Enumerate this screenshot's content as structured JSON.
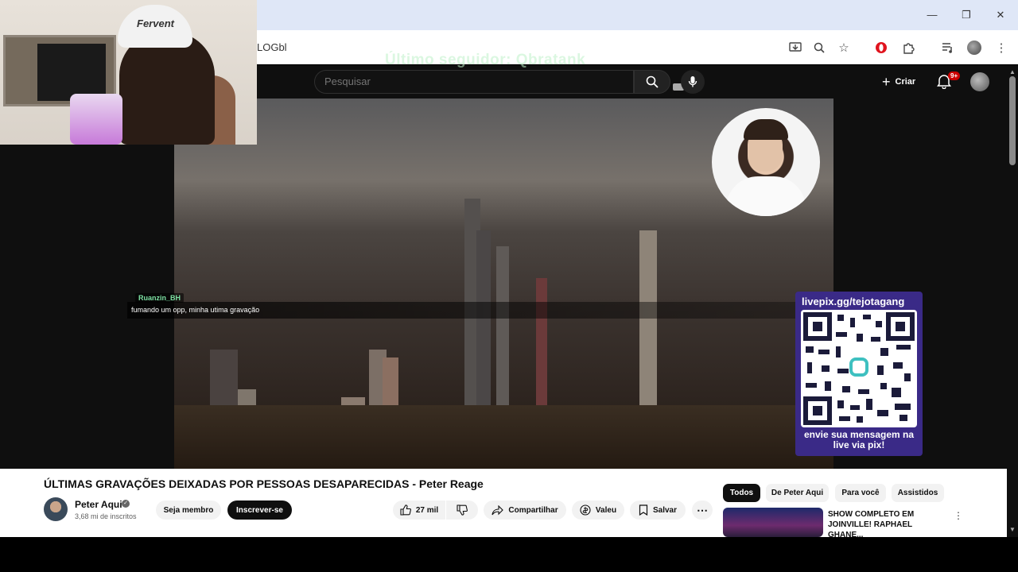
{
  "browser": {
    "url_fragment": "LOGbl",
    "window_controls": [
      "minimize",
      "restore",
      "close"
    ]
  },
  "stream_overlay": {
    "last_follower": "Último seguidor: Qbratank",
    "webcam_cap_text": "Fervent",
    "chat": {
      "username": "Ruanzin_BH",
      "message": "fumando um opp, minha utima gravação"
    },
    "donation": {
      "url": "livepix.gg/tejotagang",
      "caption_line1": "envie sua mensagem na",
      "caption_line2": "live via pix!"
    }
  },
  "youtube_header": {
    "search_placeholder": "Pesquisar",
    "create_label": "Criar",
    "notification_badge": "9+"
  },
  "video": {
    "title": "ÚLTIMAS GRAVAÇÕES DEIXADAS POR PESSOAS DESAPARECIDAS - Peter Reage",
    "channel_name": "Peter Aqui",
    "subscribers": "3,68 mi de inscritos",
    "join_label": "Seja membro",
    "subscribe_label": "Inscrever-se",
    "likes": "27 mil",
    "share_label": "Compartilhar",
    "thanks_label": "Valeu",
    "save_label": "Salvar"
  },
  "recommendations": {
    "chips": [
      "Todos",
      "De Peter Aqui",
      "Para você",
      "Assistidos"
    ],
    "active_chip": "Todos",
    "first_item_title": "SHOW COMPLETO EM JOINVILLE! RAPHAEL GHANE..."
  },
  "colors": {
    "yt_dark": "#0f0f0f",
    "subscribe_bg": "#0f0f0f",
    "badge_red": "#cc0000",
    "chat_name_green": "#7de1a3",
    "donation_panel": "#3a2a87"
  }
}
